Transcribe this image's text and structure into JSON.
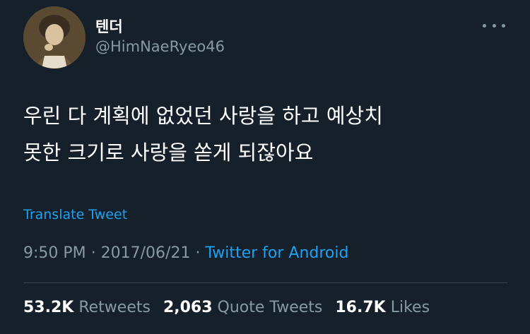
{
  "author": {
    "display_name": "텐더",
    "handle": "@HimNaeRyeo46",
    "avatar_icon": "portrait-avatar"
  },
  "tweet": {
    "lines": [
      "우린 다 계획에 없었던 사랑을 하고 예상치",
      "못한 크기로 사랑을 쏟게 되잖아요"
    ]
  },
  "translate_label": "Translate Tweet",
  "meta": {
    "time": "9:50 PM",
    "separator1": " · ",
    "date": "2017/06/21",
    "separator2": " · ",
    "source": "Twitter for Android"
  },
  "stats": {
    "retweets_count": "53.2K",
    "retweets_label": "Retweets",
    "quotes_count": "2,063",
    "quotes_label": "Quote Tweets",
    "likes_count": "16.7K",
    "likes_label": "Likes"
  },
  "colors": {
    "background": "#15202b",
    "text_primary": "#ffffff",
    "text_secondary": "#8899a6",
    "accent": "#1da1f2",
    "divider": "#38444d"
  }
}
